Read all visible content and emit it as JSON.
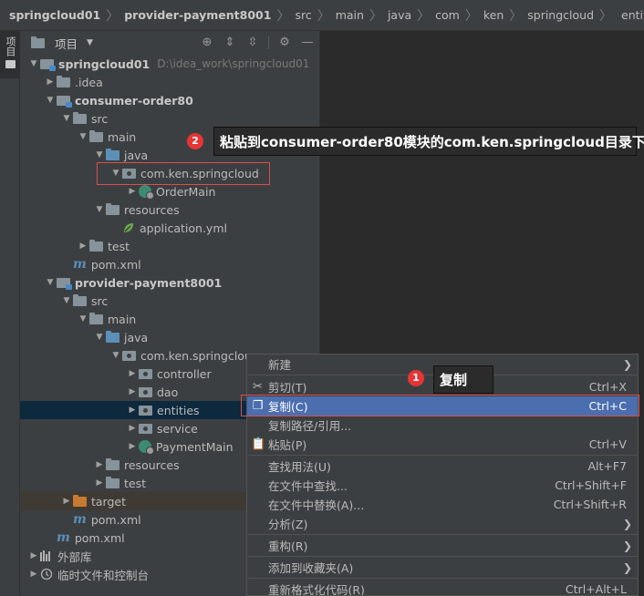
{
  "breadcrumb": [
    "springcloud01",
    "provider-payment8001",
    "src",
    "main",
    "java",
    "com",
    "ken",
    "springcloud",
    "entities"
  ],
  "toolstrip": {
    "project_tab": "项目"
  },
  "panel": {
    "title": "项目"
  },
  "tree": {
    "root": {
      "label": "springcloud01",
      "path": "D:\\idea_work\\springcloud01"
    },
    "idea": ".idea",
    "consumer": {
      "label": "consumer-order80",
      "src": "src",
      "main": "main",
      "java": "java",
      "pkg": "com.ken.springcloud",
      "order_main": "OrderMain",
      "resources": "resources",
      "application_yml": "application.yml",
      "test": "test",
      "pom": "pom.xml"
    },
    "provider": {
      "label": "provider-payment8001",
      "src": "src",
      "main": "main",
      "java": "java",
      "pkg": "com.ken.springclou",
      "controller": "controller",
      "dao": "dao",
      "entities": "entities",
      "service": "service",
      "payment_main": "PaymentMain",
      "resources": "resources",
      "test": "test",
      "target": "target",
      "pom": "pom.xml"
    },
    "root_pom": "pom.xml",
    "external_libs": "外部库",
    "scratches": "临时文件和控制台"
  },
  "callouts": {
    "step1": {
      "badge": "1",
      "text": "复制"
    },
    "step2": {
      "badge": "2",
      "text": "粘贴到consumer-order80模块的com.ken.springcloud目录下"
    }
  },
  "menu": {
    "new": "新建",
    "cut": "剪切(T)",
    "cut_key": "Ctrl+X",
    "copy": "复制(C)",
    "copy_key": "Ctrl+C",
    "copy_path": "复制路径/引用...",
    "paste": "粘贴(P)",
    "paste_key": "Ctrl+V",
    "find_usages": "查找用法(U)",
    "find_usages_key": "Alt+F7",
    "find_in_files": "在文件中查找...",
    "find_in_files_key": "Ctrl+Shift+F",
    "replace_in_files": "在文件中替换(A)...",
    "replace_in_files_key": "Ctrl+Shift+R",
    "analyze": "分析(Z)",
    "refactor": "重构(R)",
    "add_favorites": "添加到收藏夹(A)",
    "reformat": "重新格式化代码(R)",
    "reformat_key": "Ctrl+Alt+L"
  },
  "colors": {
    "selection": "#4b6eaf",
    "callout_badge": "#e53535",
    "annotation_box": "#d94f4f"
  }
}
